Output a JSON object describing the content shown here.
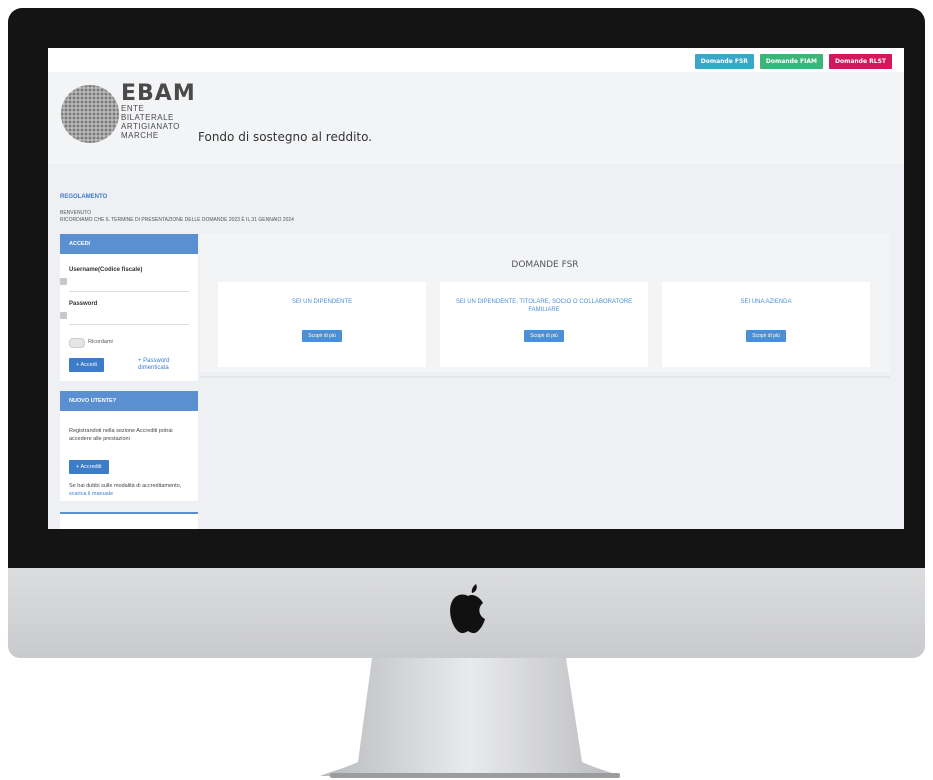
{
  "top_buttons": [
    {
      "label": "Domande FSR",
      "color": "#3aa6c8"
    },
    {
      "label": "Domande FIAM",
      "color": "#3bb57a"
    },
    {
      "label": "Domande RLST",
      "color": "#d0185b"
    }
  ],
  "logo": {
    "name": "EBAM",
    "lines": [
      "ENTE",
      "BILATERALE",
      "ARTIGIANATO",
      "MARCHE"
    ]
  },
  "header": {
    "tagline": "Fondo di sostegno al reddito."
  },
  "main": {
    "regolamento": "REGOLAMENTO",
    "welcome": "BENVENUTO",
    "notice": "RICORDIAMO CHE IL TERMINE DI PRESENTAZIONE DELLE DOMANDE 2023 È IL 31 GENNAIO 2024"
  },
  "login": {
    "header": "ACCEDI",
    "username_label": "Username(Codice fiscale)",
    "password_label": "Password",
    "remember_label": "Ricordami",
    "submit_label": "Accedi",
    "forgot_label": "Password dimenticata"
  },
  "new_user": {
    "header": "NUOVO UTENTE?",
    "text": "Registrandoti nella sezione Accrediti potrai accedere alle prestazioni",
    "button_label": "Accrediti",
    "help_text": "Se hai dubbi sulle modalità di accreditamento,",
    "help_link": "scarica il manuale"
  },
  "fsr": {
    "title": "DOMANDE FSR",
    "cards": [
      {
        "title": "SEI UN DIPENDENTE",
        "button": "Scopri di più"
      },
      {
        "title": "SEI UN DIPENDENTE, TITOLARE, SOCIO O COLLABORATORE FAMILIARE",
        "button": "Scopri di più"
      },
      {
        "title": "SEI UNA AZIENDA",
        "button": "Scopri di più"
      }
    ]
  },
  "icons": {
    "plus": "plus-icon",
    "key": "key-icon",
    "apple": "apple-logo-icon"
  }
}
